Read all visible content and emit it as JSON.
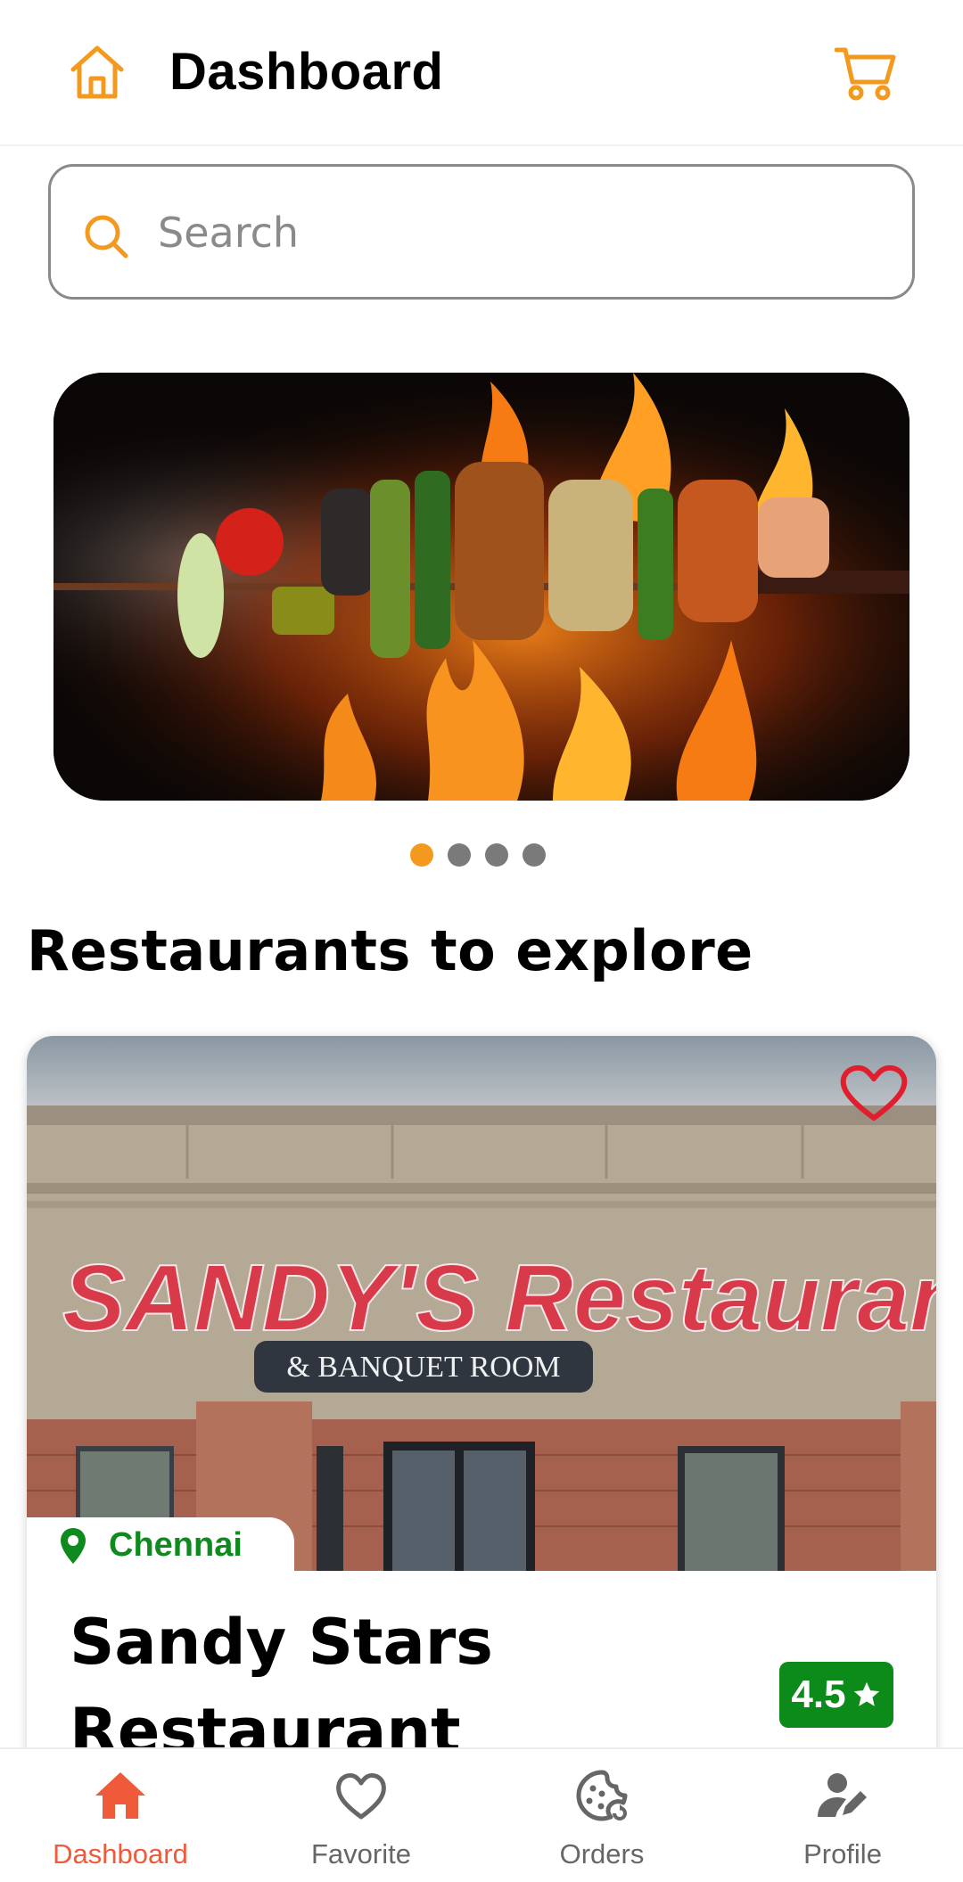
{
  "header": {
    "title": "Dashboard",
    "home_icon": "home-icon",
    "cart_icon": "cart-icon",
    "accent_color": "#f39a1e"
  },
  "search": {
    "placeholder": "Search",
    "value": ""
  },
  "banner": {
    "slides_total": 4,
    "active_slide": 1
  },
  "restaurants_section": {
    "title": "Restaurants to explore"
  },
  "restaurant_card": {
    "photo_sign_text": "SANDY'S Restaurant",
    "photo_sub_sign": "& BANQUET ROOM",
    "location": "Chennai",
    "name": "Sandy Stars Restaurant",
    "rating": "4.5",
    "favorite_icon": "heart-outline-icon",
    "location_icon": "location-pin-icon",
    "location_color": "#0f8a1e",
    "rating_color": "#0c8a1a",
    "favorite_color": "#e01e2e"
  },
  "bottom_nav": {
    "active_color": "#ef5a3a",
    "items": [
      {
        "label": "Dashboard",
        "icon": "home-filled-icon"
      },
      {
        "label": "Favorite",
        "icon": "heart-icon"
      },
      {
        "label": "Orders",
        "icon": "cookie-refresh-icon"
      },
      {
        "label": "Profile",
        "icon": "user-edit-icon"
      }
    ]
  }
}
